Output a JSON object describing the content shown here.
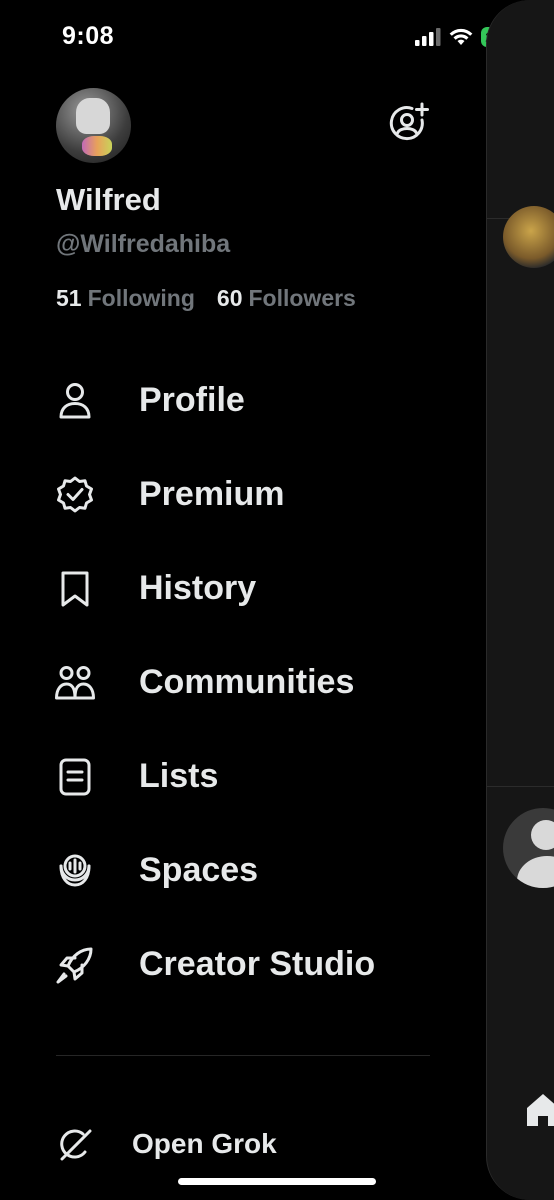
{
  "status_bar": {
    "time": "9:08",
    "battery": "25"
  },
  "profile": {
    "display_name": "Wilfred",
    "handle": "@Wilfredahiba",
    "following_count": "51",
    "following_label": "Following",
    "followers_count": "60",
    "followers_label": "Followers"
  },
  "menu": {
    "items": [
      {
        "label": "Profile",
        "icon": "person-icon"
      },
      {
        "label": "Premium",
        "icon": "verified-badge-icon"
      },
      {
        "label": "History",
        "icon": "bookmark-icon"
      },
      {
        "label": "Communities",
        "icon": "people-icon"
      },
      {
        "label": "Lists",
        "icon": "list-icon"
      },
      {
        "label": "Spaces",
        "icon": "microphone-icon"
      },
      {
        "label": "Creator Studio",
        "icon": "rocket-icon"
      }
    ]
  },
  "footer": {
    "grok_label": "Open Grok",
    "grok_icon": "grok-icon"
  },
  "colors": {
    "background": "#000000",
    "text": "#e7e9ea",
    "muted": "#71767b",
    "battery": "#34c759"
  }
}
